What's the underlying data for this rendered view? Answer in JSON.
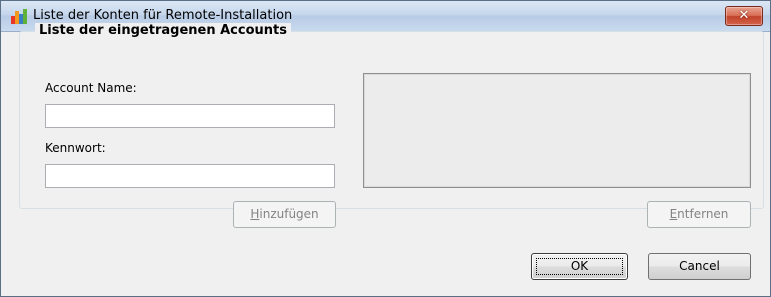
{
  "window": {
    "title": "Liste der Konten für Remote-Installation",
    "close_glyph": "✕"
  },
  "group": {
    "title": "Liste der eingetragenen Accounts"
  },
  "form": {
    "account_label": "Account Name:",
    "account_value": "",
    "password_label": "Kennwort:",
    "password_value": ""
  },
  "buttons": {
    "add_first": "H",
    "add_rest": "inzufügen",
    "remove_first": "E",
    "remove_rest": "ntfernen",
    "ok": "OK",
    "cancel": "Cancel"
  },
  "icons": {
    "app": "avg-logo-icon",
    "close": "close-icon"
  },
  "colors": {
    "title_bar": "#c6d7ec",
    "close_button": "#d96d53",
    "list_background": "#ececec",
    "disabled_text": "#838383"
  }
}
